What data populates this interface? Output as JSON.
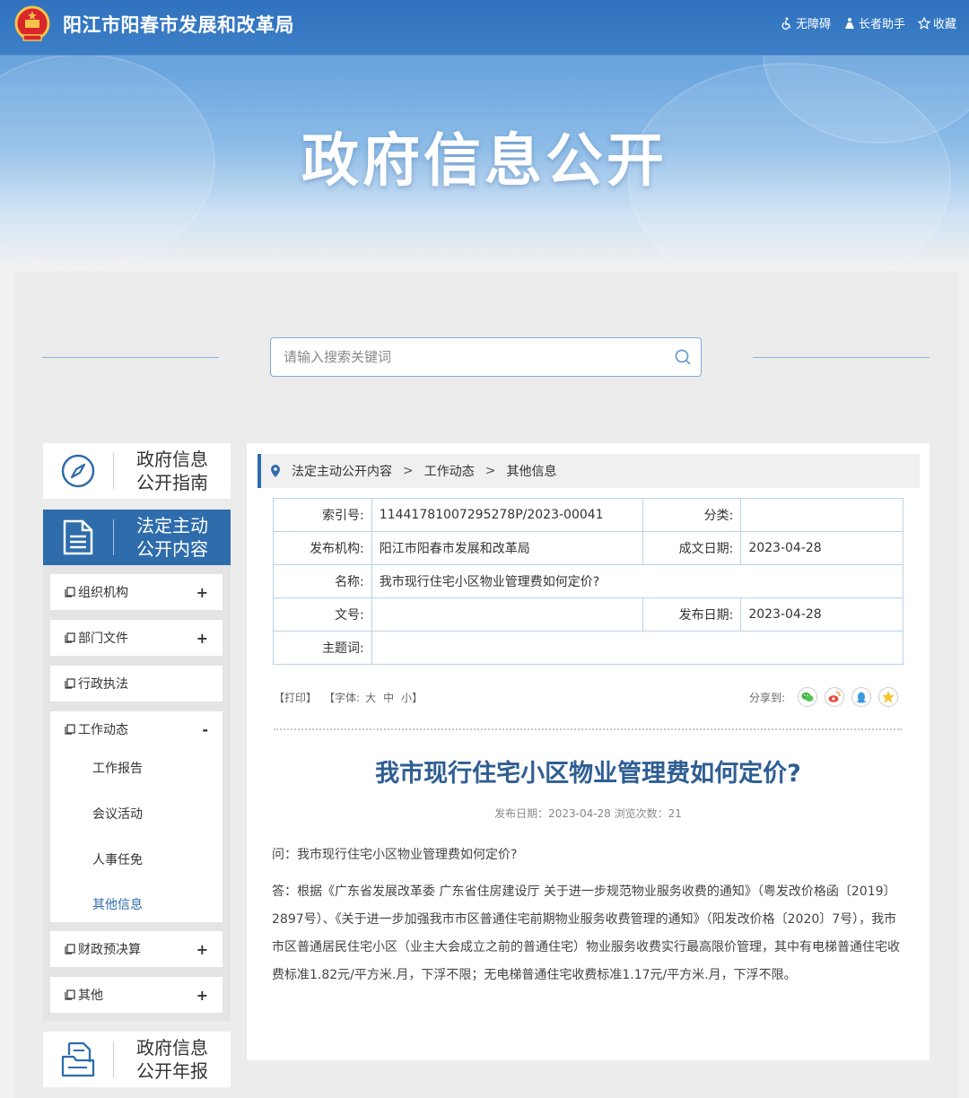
{
  "header": {
    "site_name": "阳江市阳春市发展和改革局",
    "hero_title": "政府信息公开",
    "links": [
      {
        "label": "无障碍",
        "icon": "accessibility-icon"
      },
      {
        "label": "长者助手",
        "icon": "elder-assistant-icon"
      },
      {
        "label": "收藏",
        "icon": "star-icon"
      }
    ],
    "colors": {
      "topbar": "#2f71bd",
      "accent": "#2f6cac"
    }
  },
  "search": {
    "placeholder": "请输入搜索关键词",
    "icon": "search-icon"
  },
  "sidebar": {
    "guide": {
      "line1": "政府信息",
      "line2": "公开指南",
      "icon": "compass-icon"
    },
    "active_block": {
      "line1": "法定主动",
      "line2": "公开内容",
      "icon": "document-icon"
    },
    "annual": {
      "line1": "政府信息",
      "line2": "公开年报",
      "icon": "report-folder-icon"
    },
    "menu": [
      {
        "label": "组织机构",
        "toggle": "+"
      },
      {
        "label": "部门文件",
        "toggle": "+"
      },
      {
        "label": "行政执法",
        "toggle": ""
      },
      {
        "label": "工作动态",
        "toggle": "-"
      },
      {
        "label": "财政预决算",
        "toggle": "+"
      },
      {
        "label": "其他",
        "toggle": "+"
      }
    ],
    "submenu": [
      "工作报告",
      "会议活动",
      "人事任免",
      "其他信息"
    ]
  },
  "breadcrumb": [
    "法定主动公开内容",
    "工作动态",
    "其他信息"
  ],
  "meta": {
    "index_label": "索引号:",
    "index_value": "11441781007295278P/2023-00041",
    "category_label": "分类:",
    "category_value": "",
    "publisher_label": "发布机构:",
    "publisher_value": "阳江市阳春市发展和改革局",
    "created_label": "成文日期:",
    "created_value": "2023-04-28",
    "name_label": "名称:",
    "name_value": "我市现行住宅小区物业管理费如何定价?",
    "docno_label": "文号:",
    "docno_value": "",
    "pubdate_label": "发布日期:",
    "pubdate_value": "2023-04-28",
    "keywords_label": "主题词:",
    "keywords_value": ""
  },
  "tools": {
    "print": "【打印】",
    "font_prefix": "【字体:",
    "font_large": "大",
    "font_medium": "中",
    "font_small": "小",
    "font_suffix": "】",
    "share_label": "分享到:",
    "share_icons": [
      "wechat-icon",
      "weibo-icon",
      "qq-icon",
      "qzone-icon"
    ]
  },
  "article": {
    "title": "我市现行住宅小区物业管理费如何定价?",
    "meta": "发布日期：2023-04-28  浏览次数：21",
    "question": "问：我市现行住宅小区物业管理费如何定价?",
    "answer": "答：根据《广东省发展改革委 广东省住房建设厅 关于进一步规范物业服务收费的通知》（粤发改价格函〔2019〕2897号）、《关于进一步加强我市市区普通住宅前期物业服务收费管理的通知》（阳发改价格〔2020〕7号），我市市区普通居民住宅小区（业主大会成立之前的普通住宅）物业服务收费实行最高限价管理，其中有电梯普通住宅收费标准1.82元/平方米.月，下浮不限；无电梯普通住宅收费标准1.17元/平方米.月，下浮不限。"
  }
}
